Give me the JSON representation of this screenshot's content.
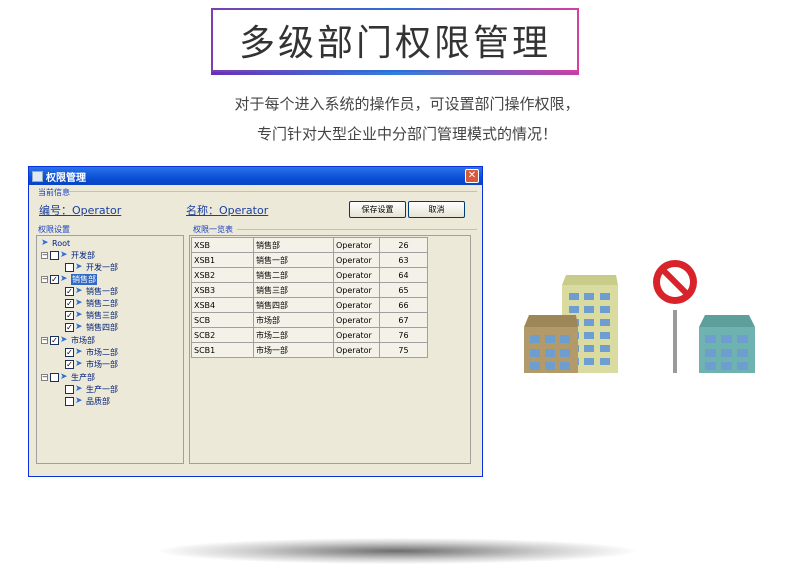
{
  "page_title": "多级部门权限管理",
  "description": {
    "line1": "对于每个进入系统的操作员，可设置部门操作权限，",
    "line2": "专门针对大型企业中分部门管理模式的情况！"
  },
  "window": {
    "title": "权限管理",
    "close_glyph": "✕",
    "current_info_label": "当前信息",
    "number_text": "编号：Operator",
    "name_text": "名称：Operator",
    "save_label": "保存设置",
    "cancel_label": "取消",
    "permission_settings_label": "权限设置",
    "permission_list_label": "权限一览表"
  },
  "tree": {
    "root": "Root",
    "groups": [
      {
        "label": "开发部",
        "checked": false,
        "children": [
          {
            "label": "开发一部",
            "checked": false
          }
        ]
      },
      {
        "label": "销售部",
        "checked": true,
        "selected": true,
        "children": [
          {
            "label": "销售一部",
            "checked": true
          },
          {
            "label": "销售二部",
            "checked": true
          },
          {
            "label": "销售三部",
            "checked": true
          },
          {
            "label": "销售四部",
            "checked": true
          }
        ]
      },
      {
        "label": "市场部",
        "checked": true,
        "children": [
          {
            "label": "市场二部",
            "checked": true
          },
          {
            "label": "市场一部",
            "checked": true
          }
        ]
      },
      {
        "label": "生产部",
        "checked": false,
        "children": [
          {
            "label": "生产一部",
            "checked": false
          },
          {
            "label": "品质部",
            "checked": false
          }
        ]
      }
    ]
  },
  "table": {
    "rows": [
      [
        "XSB",
        "销售部",
        "Operator",
        "26"
      ],
      [
        "XSB1",
        "销售一部",
        "Operator",
        "63"
      ],
      [
        "XSB2",
        "销售二部",
        "Operator",
        "64"
      ],
      [
        "XSB3",
        "销售三部",
        "Operator",
        "65"
      ],
      [
        "XSB4",
        "销售四部",
        "Operator",
        "66"
      ],
      [
        "SCB",
        "市场部",
        "Operator",
        "67"
      ],
      [
        "SCB2",
        "市场二部",
        "Operator",
        "76"
      ],
      [
        "SCB1",
        "市场一部",
        "Operator",
        "75"
      ]
    ]
  },
  "colors": {
    "window_bg": "#ece9d8",
    "titlebar_blue": "#0a4fd6",
    "no_sign_red": "#d9232b",
    "building_yellow": "#d9dba0",
    "building_brown": "#b39a6a",
    "building_teal": "#6fb3b0",
    "window_blue": "#6d9ecf"
  },
  "icons": [
    "window-app-icon",
    "close-icon",
    "node-icon",
    "expand-icon",
    "checkbox-icon",
    "no-entry-sign-icon",
    "buildings-icon"
  ]
}
